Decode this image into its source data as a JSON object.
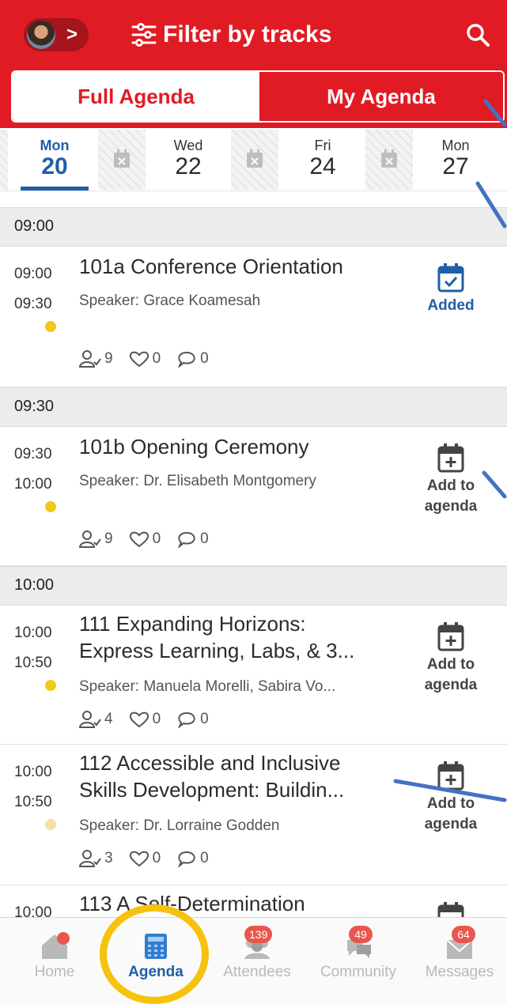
{
  "header": {
    "title": "Filter by tracks",
    "avatar_chevron": ">"
  },
  "segments": {
    "full_agenda": "Full Agenda",
    "my_agenda": "My Agenda"
  },
  "dates": [
    {
      "dow": "Mon",
      "day": "20",
      "active": true
    },
    {
      "dow": "Wed",
      "day": "22",
      "active": false
    },
    {
      "dow": "Fri",
      "day": "24",
      "active": false
    },
    {
      "dow": "Mon",
      "day": "27",
      "active": false
    }
  ],
  "time_headers": [
    "09:00",
    "09:30",
    "10:00"
  ],
  "sessions": [
    {
      "start": "09:00",
      "end": "09:30",
      "title": "101a Conference Orientation",
      "speaker": "Speaker: Grace Koamesah",
      "attendees": "9",
      "likes": "0",
      "comments": "0",
      "action": "Added",
      "dot_color": "#f2c919"
    },
    {
      "start": "09:30",
      "end": "10:00",
      "title": "101b Opening Ceremony",
      "speaker": "Speaker: Dr. Elisabeth Montgomery",
      "attendees": "9",
      "likes": "0",
      "comments": "0",
      "action": "Add to agenda",
      "dot_color": "#f2c919"
    },
    {
      "start": "10:00",
      "end": "10:50",
      "title_line1": "111 Expanding Horizons:",
      "title_line2": "Express Learning, Labs, & 3...",
      "speaker": "Speaker: Manuela Morelli, Sabira Vo...",
      "attendees": "4",
      "likes": "0",
      "comments": "0",
      "action": "Add to agenda",
      "dot_color": "#f2c919"
    },
    {
      "start": "10:00",
      "end": "10:50",
      "title_line1": "112 Accessible and Inclusive",
      "title_line2": "Skills Development: Buildin...",
      "speaker": "Speaker: Dr. Lorraine Godden",
      "attendees": "3",
      "likes": "0",
      "comments": "0",
      "action": "Add to agenda",
      "dot_color": "#f3e2a6"
    },
    {
      "start": "10:00",
      "title_line1": "113 A Self-Determination"
    }
  ],
  "action_labels": {
    "added": "Added",
    "add_line1": "Add to",
    "add_line2": "agenda"
  },
  "nav": [
    {
      "label": "Home",
      "badge": ""
    },
    {
      "label": "Agenda",
      "badge": "",
      "active": true
    },
    {
      "label": "Attendees",
      "badge": "139"
    },
    {
      "label": "Community",
      "badge": "49"
    },
    {
      "label": "Messages",
      "badge": "64"
    }
  ],
  "colors": {
    "brand_red": "#e01b24",
    "active_blue": "#1f5fa8",
    "dot_yellow": "#f2c919",
    "badge_red": "#e8564d",
    "highlight_yellow": "#f6c20b",
    "annotation_blue": "#4472c4"
  },
  "icons": {
    "avatar": "avatar",
    "filter": "sliders-icon",
    "search": "search-icon",
    "added": "calendar-check-icon",
    "add": "calendar-plus-icon",
    "attendees": "people-icon",
    "likes": "heart-icon",
    "comments": "chat-bubble-icon",
    "home": "home-icon",
    "agenda": "calculator-calendar-icon",
    "attendees_nav": "group-icon",
    "community": "chat-icon",
    "messages": "envelope-icon"
  }
}
